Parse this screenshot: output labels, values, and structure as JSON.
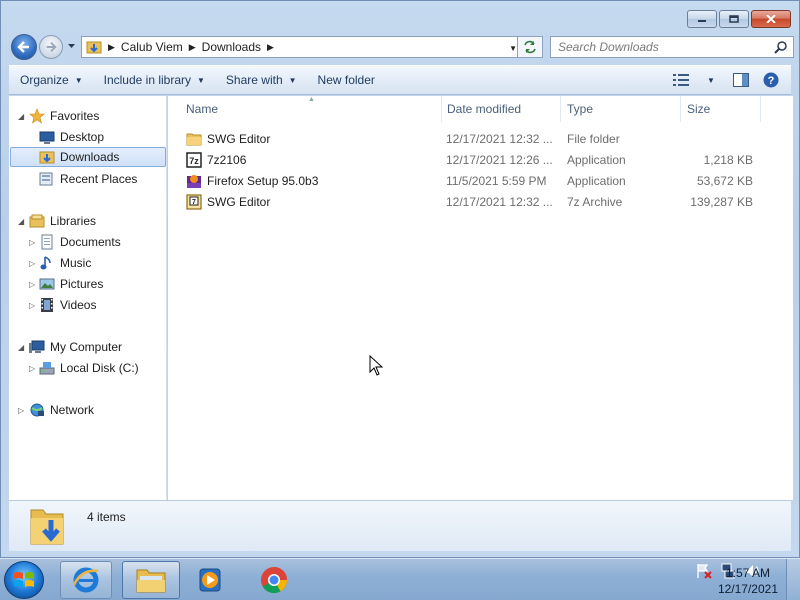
{
  "window": {
    "caption_buttons": [
      {
        "name": "minimize-button",
        "icon": "minimize-icon"
      },
      {
        "name": "maximize-button",
        "icon": "maximize-icon"
      },
      {
        "name": "close-button",
        "icon": "close-icon"
      }
    ]
  },
  "address_bar": {
    "breadcrumbs": [
      "Calub Viem",
      "Downloads"
    ],
    "search_placeholder": "Search Downloads"
  },
  "toolbar": {
    "organize": "Organize",
    "include_in_library": "Include in library",
    "share_with": "Share with",
    "new_folder": "New folder"
  },
  "nav_pane": {
    "favorites": {
      "label": "Favorites",
      "items": [
        {
          "label": "Desktop"
        },
        {
          "label": "Downloads"
        },
        {
          "label": "Recent Places"
        }
      ]
    },
    "libraries": {
      "label": "Libraries",
      "items": [
        {
          "label": "Documents"
        },
        {
          "label": "Music"
        },
        {
          "label": "Pictures"
        },
        {
          "label": "Videos"
        }
      ]
    },
    "computer": {
      "label": "My Computer",
      "items": [
        {
          "label": "Local Disk (C:)"
        }
      ]
    },
    "network": {
      "label": "Network"
    }
  },
  "file_list": {
    "columns": [
      "Name",
      "Date modified",
      "Type",
      "Size"
    ],
    "rows": [
      {
        "name": "SWG Editor",
        "date": "12/17/2021 12:32 ...",
        "type": "File folder",
        "size": "",
        "icon": "folder-icon"
      },
      {
        "name": "7z2106",
        "date": "12/17/2021 12:26 ...",
        "type": "Application",
        "size": "1,218 KB",
        "icon": "7zip-app-icon"
      },
      {
        "name": "Firefox Setup 95.0b3",
        "date": "11/5/2021 5:59 PM",
        "type": "Application",
        "size": "53,672 KB",
        "icon": "firefox-setup-icon"
      },
      {
        "name": "SWG Editor",
        "date": "12/17/2021 12:32 ...",
        "type": "7z Archive",
        "size": "139,287 KB",
        "icon": "7z-archive-icon"
      }
    ]
  },
  "details_pane": {
    "item_count": "4 items"
  },
  "taskbar": {
    "pinned": [
      "internet-explorer-icon",
      "windows-explorer-icon",
      "media-player-icon",
      "chrome-icon"
    ],
    "clock_time": "1:57 AM",
    "clock_date": "12/17/2021"
  },
  "colors": {
    "selection": "#cfe0f7",
    "selection_border": "#84acdd",
    "header_text": "#4c607a",
    "taskbar": "#8fb0d6"
  }
}
